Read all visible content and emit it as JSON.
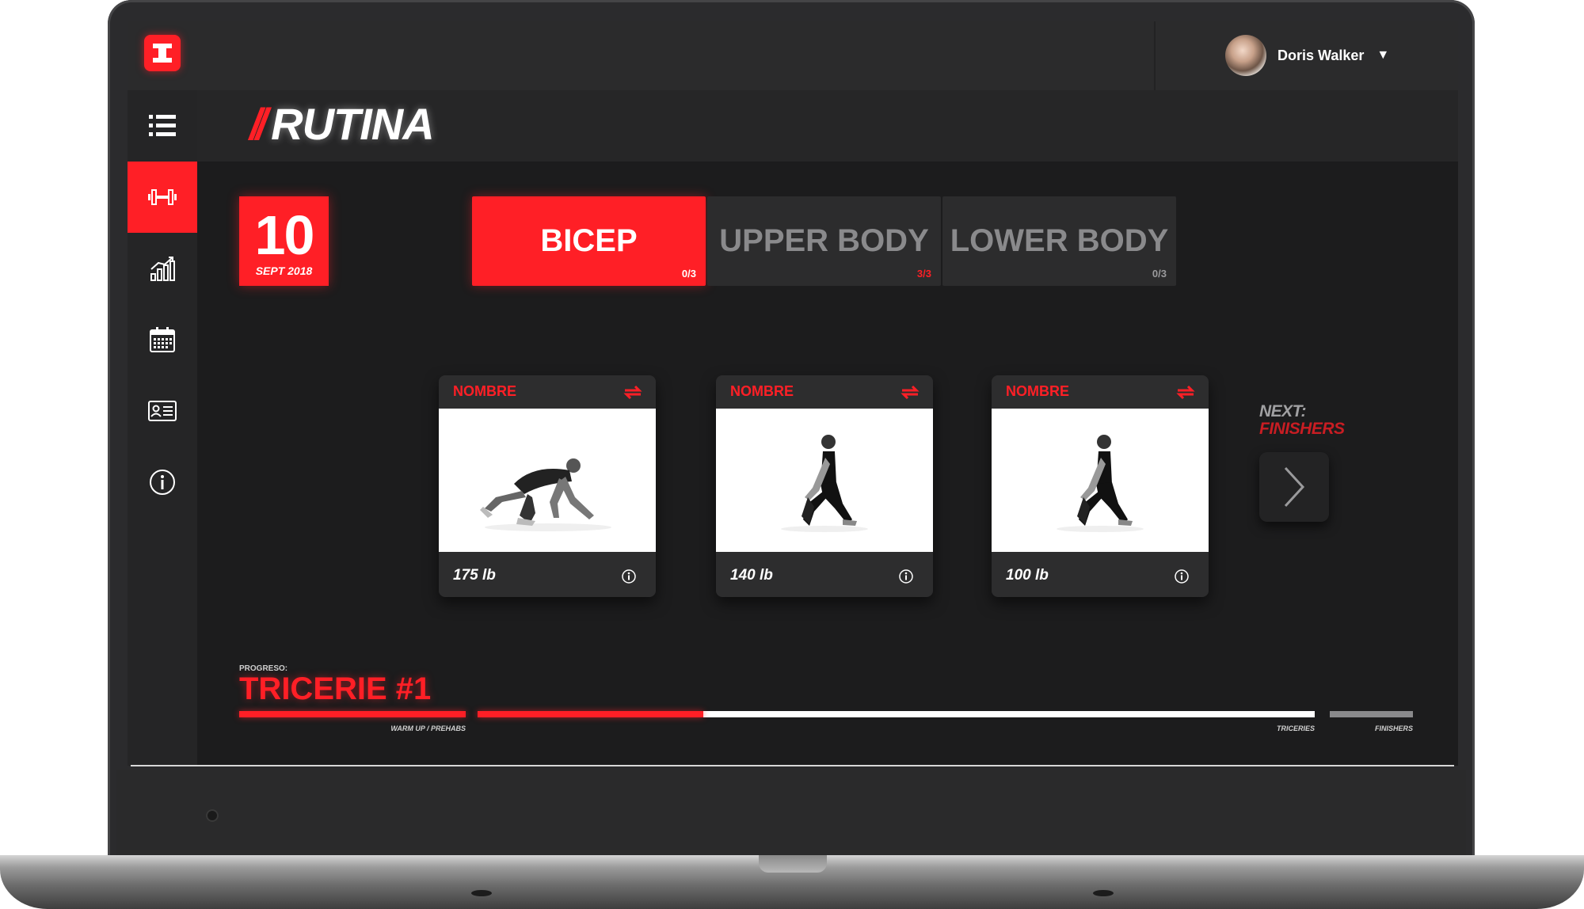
{
  "user": {
    "name": "Doris Walker"
  },
  "page": {
    "title": "RUTINA",
    "title_prefix": "//"
  },
  "date": {
    "day": "10",
    "month_year": "SEPT 2018"
  },
  "tabs": [
    {
      "label": "BICEP",
      "count": "0/3",
      "active": true
    },
    {
      "label": "UPPER BODY",
      "count": "3/3",
      "active": false
    },
    {
      "label": "LOWER BODY",
      "count": "0/3",
      "active": false
    }
  ],
  "exercises": [
    {
      "name": "NOMBRE",
      "weight": "175 lb",
      "image": "man-crawl-stretch"
    },
    {
      "name": "NOMBRE",
      "weight": "140 lb",
      "image": "woman-lunge-quad-stretch"
    },
    {
      "name": "NOMBRE",
      "weight": "100 lb",
      "image": "woman-lunge-quad-stretch"
    }
  ],
  "next": {
    "prefix": "NEXT:",
    "label": "FINISHERS"
  },
  "progress": {
    "label": "PROGRESO:",
    "title": "TRICERIE #1",
    "segments": [
      {
        "caption": "WARM UP / PREHABS",
        "fill": 1.0
      },
      {
        "caption": "TRICERIES",
        "fill": 0.27
      },
      {
        "caption": "FINISHERS",
        "fill": 0.0
      }
    ]
  },
  "sidebar": [
    {
      "icon": "list-icon"
    },
    {
      "icon": "dumbbell-icon",
      "active": true
    },
    {
      "icon": "chart-icon"
    },
    {
      "icon": "calendar-icon"
    },
    {
      "icon": "id-card-icon"
    },
    {
      "icon": "info-icon"
    }
  ],
  "colors": {
    "accent": "#ff1f26",
    "background": "#1c1c1d",
    "panel": "#2b2b2c"
  }
}
